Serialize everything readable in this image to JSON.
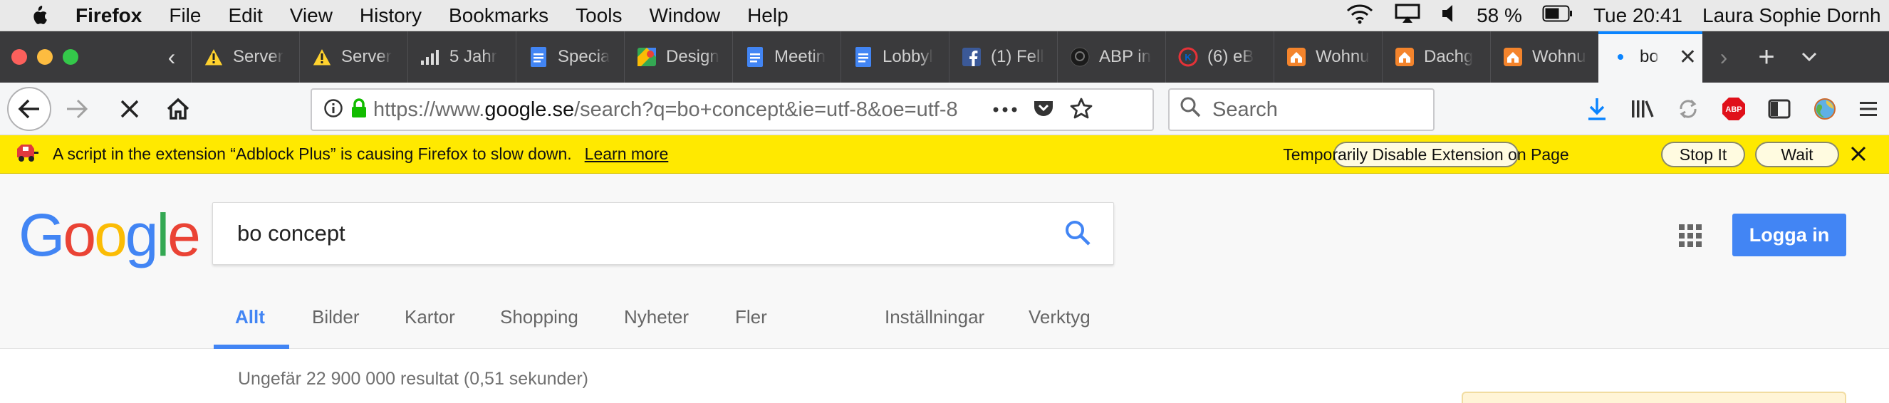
{
  "menubar": {
    "app_name": "Firefox",
    "menus": [
      "File",
      "Edit",
      "View",
      "History",
      "Bookmarks",
      "Tools",
      "Window",
      "Help"
    ],
    "battery": "58 %",
    "clock": "Tue 20:41",
    "user": "Laura Sophie Dornh"
  },
  "tabs": [
    {
      "title": "Server",
      "icon": "warning-icon"
    },
    {
      "title": "Server",
      "icon": "warning-icon"
    },
    {
      "title": "5 Jahr",
      "icon": "signal-bars-icon"
    },
    {
      "title": "Specia",
      "icon": "google-docs-icon"
    },
    {
      "title": "Design",
      "icon": "google-maps-icon"
    },
    {
      "title": "Meetin",
      "icon": "google-docs-icon"
    },
    {
      "title": "Lobbyl",
      "icon": "google-docs-icon"
    },
    {
      "title": "(1) Fell",
      "icon": "facebook-icon"
    },
    {
      "title": "ABP in",
      "icon": "github-icon"
    },
    {
      "title": "(6) eB",
      "icon": "ebay-icon"
    },
    {
      "title": "Wohnu",
      "icon": "house-icon"
    },
    {
      "title": "Dachg",
      "icon": "house-icon"
    },
    {
      "title": "Wohnu",
      "icon": "house-icon"
    },
    {
      "title": "bo",
      "icon": "loading-dot-icon",
      "active": true
    }
  ],
  "navbar": {
    "url_prefix": "https://www.",
    "url_domain": "google.se",
    "url_rest": "/search?q=bo+concept&ie=utf-8&oe=utf-8",
    "search_placeholder": "Search"
  },
  "notification": {
    "message": "A script in the extension “Adblock Plus” is causing Firefox to slow down.",
    "learn_more": "Learn more",
    "btn_disable": "Temporarily Disable Extension on Page",
    "btn_stop": "Stop It",
    "btn_wait": "Wait"
  },
  "google": {
    "logo_letters": [
      "G",
      "o",
      "o",
      "g",
      "l",
      "e"
    ],
    "query": "bo concept",
    "login": "Logga in",
    "tabs": [
      "Allt",
      "Bilder",
      "Kartor",
      "Shopping",
      "Nyheter",
      "Fler"
    ],
    "tools": [
      "Inställningar",
      "Verktyg"
    ],
    "stats": "Ungefär 22 900 000 resultat (0,51 sekunder)"
  },
  "colors": {
    "accent": "#0a84ff",
    "notification": "#ffe900",
    "google_blue": "#4285f4",
    "google_red": "#ea4335",
    "google_yellow": "#fbbc05",
    "google_green": "#34a853"
  }
}
